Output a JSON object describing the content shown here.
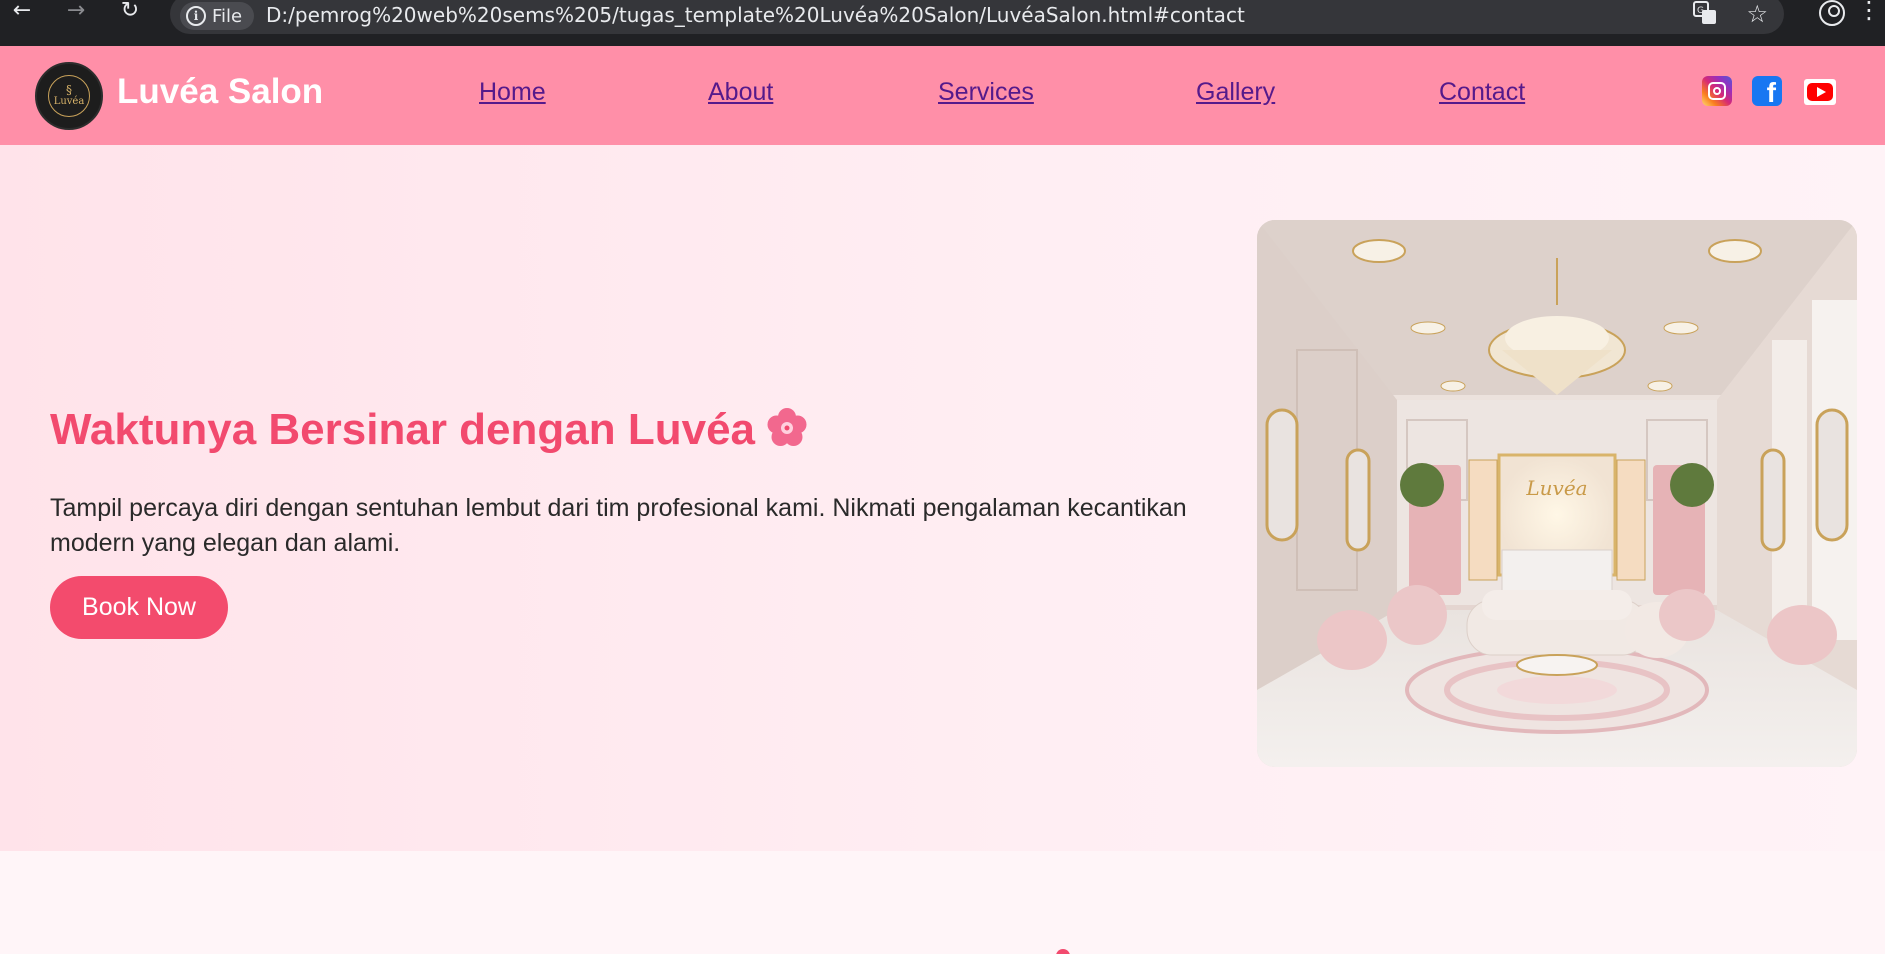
{
  "browser": {
    "file_label": "File",
    "url": "D:/pemrog%20web%20sems%205/tugas_template%20Luvéa%20Salon/LuvéaSalon.html#contact"
  },
  "header": {
    "brand": "Luvéa Salon",
    "logo_text": "Luvéa",
    "nav": [
      "Home",
      "About",
      "Services",
      "Gallery",
      "Contact"
    ],
    "social_icons": [
      "instagram-icon",
      "facebook-icon",
      "youtube-icon"
    ]
  },
  "hero": {
    "title": "Waktunya Bersinar dengan Luvéa",
    "description": "Tampil percaya diri dengan sentuhan lembut dari tim profesional kami. Nikmati pengalaman kecantikan modern yang elegan dan alami.",
    "button_label": "Book Now",
    "image_sign_text": "Luvéa"
  },
  "colors": {
    "header_bg": "#ff8fa8",
    "accent": "#f24a6e",
    "nav_link": "#551a8b",
    "hero_bg": "#ffeef3"
  }
}
